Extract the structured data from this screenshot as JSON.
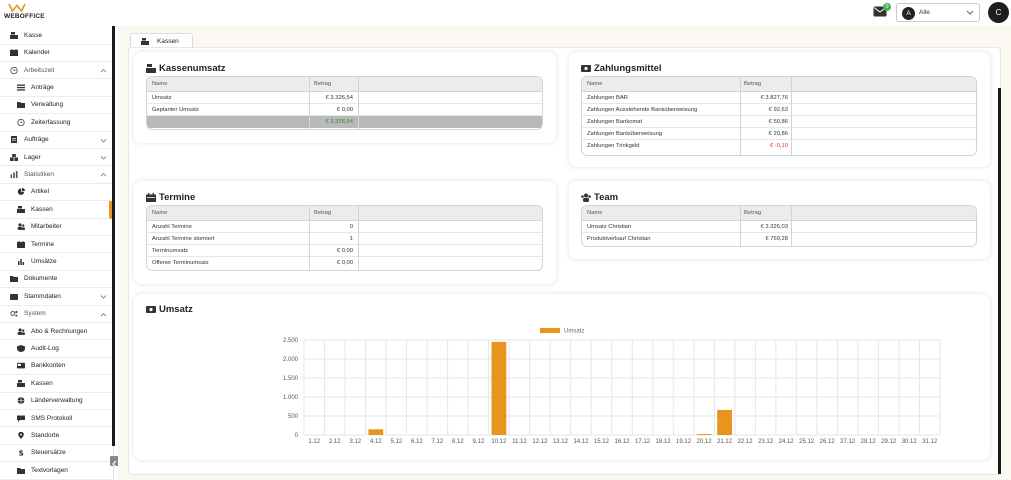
{
  "brand": {
    "name": "WEBOFFICE",
    "accent": "#e8951d"
  },
  "header": {
    "mail_badge": "0",
    "user_filter": {
      "avatar_letter": "A",
      "value": "Alle"
    },
    "avatar_letter": "C"
  },
  "sidebar": {
    "items": [
      {
        "label": "Kasse",
        "icon": "cash-register-icon",
        "level": 0
      },
      {
        "label": "Kalender",
        "icon": "calendar-icon",
        "level": 0
      },
      {
        "label": "Arbeitszeit",
        "icon": "clock-icon",
        "level": 0,
        "section": true,
        "expanded": true
      },
      {
        "label": "Anträge",
        "icon": "list-icon",
        "level": 1
      },
      {
        "label": "Verwaltung",
        "icon": "folder-icon",
        "level": 1
      },
      {
        "label": "Zeiterfassung",
        "icon": "clock-icon",
        "level": 1
      },
      {
        "label": "Aufträge",
        "icon": "document-icon",
        "level": 0,
        "collapsed": true
      },
      {
        "label": "Lager",
        "icon": "boxes-icon",
        "level": 0,
        "collapsed": true
      },
      {
        "label": "Statistiken",
        "icon": "chart-icon",
        "level": 0,
        "section": true,
        "expanded": true
      },
      {
        "label": "Artikel",
        "icon": "pie-icon",
        "level": 1
      },
      {
        "label": "Kassen",
        "icon": "cash-register-icon",
        "level": 1,
        "active": true
      },
      {
        "label": "Mitarbeiter",
        "icon": "users-icon",
        "level": 1
      },
      {
        "label": "Termine",
        "icon": "calendar-icon",
        "level": 1
      },
      {
        "label": "Umsätze",
        "icon": "bar-chart-icon",
        "level": 1
      },
      {
        "label": "Dokumente",
        "icon": "folder-icon",
        "level": 0
      },
      {
        "label": "Stammdaten",
        "icon": "database-icon",
        "level": 0,
        "collapsed": true
      },
      {
        "label": "System",
        "icon": "gears-icon",
        "level": 0,
        "section": true,
        "expanded": true
      },
      {
        "label": "Abo & Rechnungen",
        "icon": "users-icon",
        "level": 1
      },
      {
        "label": "Audit-Log",
        "icon": "shield-icon",
        "level": 1
      },
      {
        "label": "Bankkonten",
        "icon": "bank-card-icon",
        "level": 1
      },
      {
        "label": "Kassen",
        "icon": "cash-register-icon",
        "level": 1
      },
      {
        "label": "Länderverwaltung",
        "icon": "globe-icon",
        "level": 1
      },
      {
        "label": "SMS Protokoll",
        "icon": "sms-icon",
        "level": 1
      },
      {
        "label": "Standorte",
        "icon": "map-pin-icon",
        "level": 1
      },
      {
        "label": "Steuersätze",
        "icon": "dollar-icon",
        "level": 1
      },
      {
        "label": "Textvorlagen",
        "icon": "folder-icon",
        "level": 1
      }
    ]
  },
  "tab": {
    "label": "Kassen"
  },
  "kassenumsatz": {
    "title": "Kassenumsatz",
    "columns": [
      "Name",
      "Betrag"
    ],
    "rows": [
      {
        "name": "Umsatz",
        "amount": "€ 3.326,54"
      },
      {
        "name": "Geplanter Umsatz",
        "amount": "€ 0,00"
      }
    ],
    "total": "€ 3.326,54"
  },
  "zahlungsmittel": {
    "title": "Zahlungsmittel",
    "columns": [
      "Name",
      "Betrag"
    ],
    "rows": [
      {
        "name": "Zahlungen BAR",
        "amount": "€ 3.827,76"
      },
      {
        "name": "Zahlungen Ausstehende Banküberweisung",
        "amount": "€ 92,63"
      },
      {
        "name": "Zahlungen Bankomat",
        "amount": "€ 50,86"
      },
      {
        "name": "Zahlungen Banküberweisung",
        "amount": "€ 20,86"
      },
      {
        "name": "Zahlungen Trinkgeld",
        "amount": "€ -0,10",
        "negative": true
      }
    ]
  },
  "termine": {
    "title": "Termine",
    "columns": [
      "Name",
      "Betrag"
    ],
    "rows": [
      {
        "name": "Anzahl Termine",
        "amount": "0"
      },
      {
        "name": "Anzahl Termine storniert",
        "amount": "1"
      },
      {
        "name": "Terminumsatz",
        "amount": "€ 0,00"
      },
      {
        "name": "Offener Terminumsatz",
        "amount": "€ 0,00"
      }
    ]
  },
  "team": {
    "title": "Team",
    "columns": [
      "Name",
      "Betrag"
    ],
    "rows": [
      {
        "name": "Umsatz Christian",
        "amount": "€ 3.326,03"
      },
      {
        "name": "Produktverkauf Christian",
        "amount": "€ 769,28"
      }
    ]
  },
  "umsatz_title": "Umsatz",
  "chart_data": {
    "type": "bar",
    "categories": [
      "1.12",
      "2.12",
      "3.12",
      "4.12",
      "5.12",
      "6.12",
      "7.12",
      "8.12",
      "9.12",
      "10.12",
      "11.12",
      "12.12",
      "13.12",
      "14.12",
      "15.12",
      "16.12",
      "17.12",
      "18.12",
      "19.12",
      "20.12",
      "21.12",
      "22.12",
      "23.12",
      "24.12",
      "25.12",
      "26.12",
      "27.12",
      "28.12",
      "29.12",
      "30.12",
      "31.12"
    ],
    "series": [
      {
        "name": "Umsatz",
        "color": "#e8951d",
        "values": [
          0,
          0,
          0,
          150,
          0,
          0,
          0,
          0,
          0,
          2450,
          0,
          0,
          0,
          0,
          0,
          0,
          0,
          0,
          0,
          25,
          660,
          0,
          0,
          0,
          0,
          0,
          0,
          0,
          0,
          0,
          0
        ]
      }
    ],
    "yticks": [
      "2.500",
      "2.000",
      "1.500",
      "1.000",
      "500",
      "0"
    ],
    "ylim": [
      0,
      2500
    ],
    "grid": true,
    "legend": "top-center"
  }
}
